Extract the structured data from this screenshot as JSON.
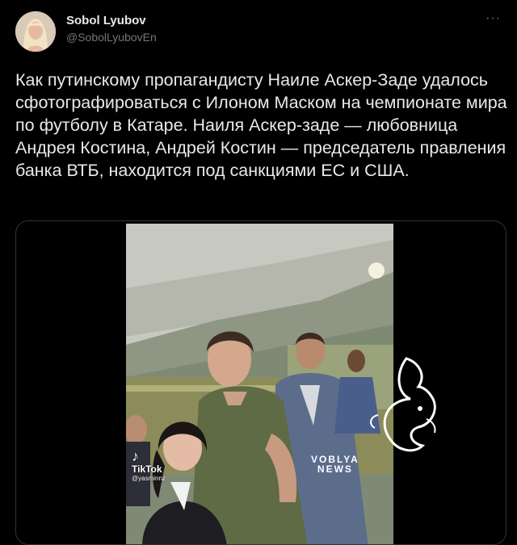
{
  "author": {
    "name": "Sobol Lyubov",
    "handle": "@SobolLyubovEn",
    "avatar": "avatar-photo"
  },
  "menu_icon": "more-options-icon",
  "tweet_text": "Как путинскому пропагандисту Наиле Аскер-Заде удалось сфотографироваться с Илоном Маском на чемпионате мира по футболу в Катаре. Наиля Аскер-заде — любовница Андрея Костина, Андрей Костин — председатель правления банка ВТБ, находится под санкциями ЕС и США.",
  "media": {
    "watermark_app": "TikTok",
    "watermark_user": "@yasminnz",
    "brand_line1": "VOBLYA",
    "brand_line2": "NEWS"
  },
  "colors": {
    "background": "#000000",
    "primary_text": "#e7e9ea",
    "secondary_text": "#71767b",
    "border": "#2f3336"
  }
}
